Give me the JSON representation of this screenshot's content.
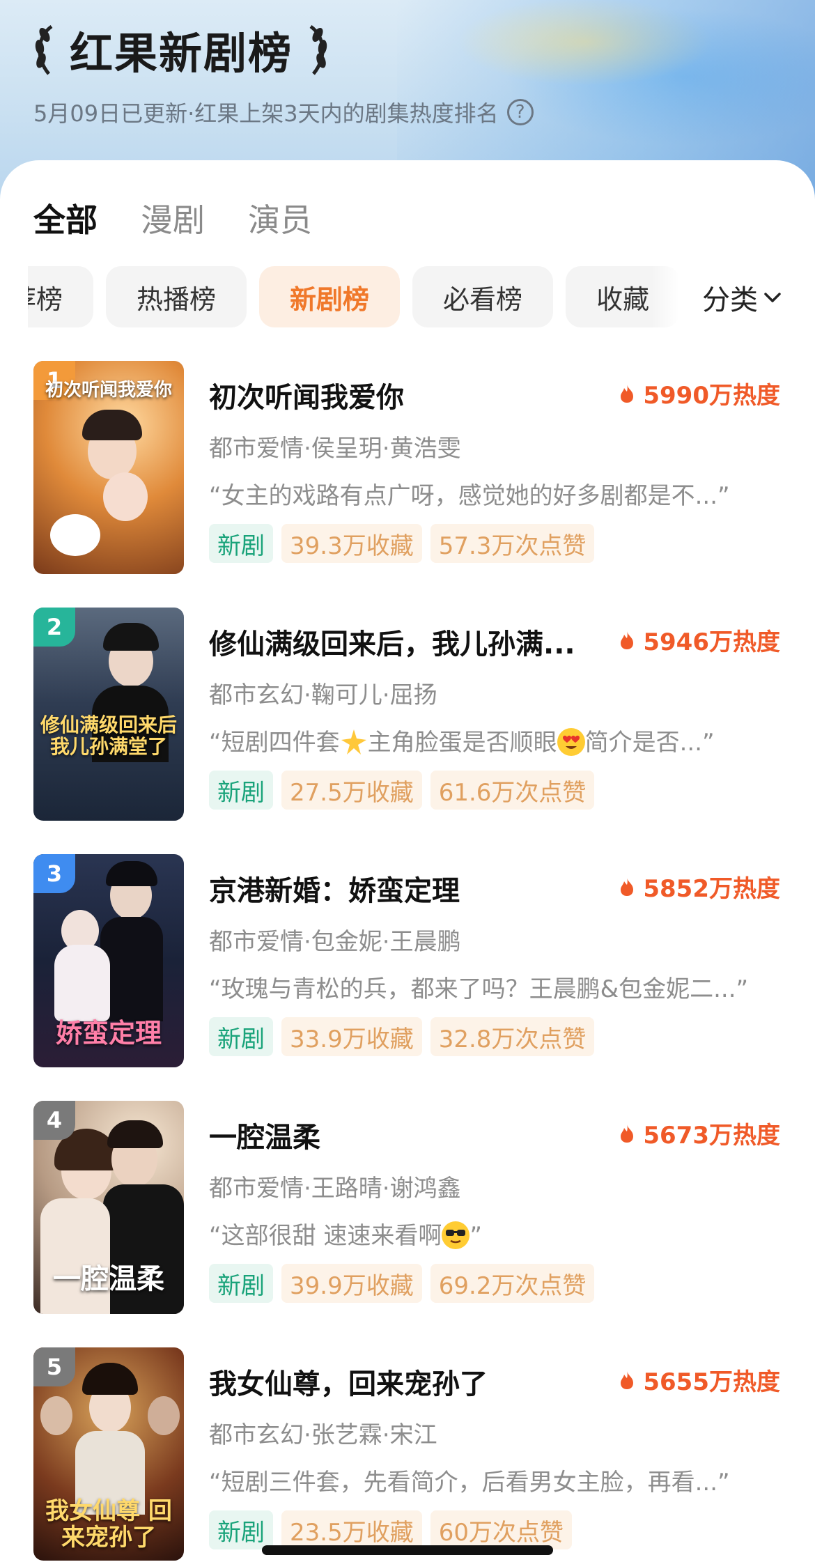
{
  "header": {
    "title": "红果新剧榜",
    "subtitle": "5月09日已更新·红果上架3天内的剧集热度排名",
    "help_glyph": "?"
  },
  "tabs": [
    "全部",
    "漫剧",
    "演员"
  ],
  "chips": [
    "荐榜",
    "热播榜",
    "新剧榜",
    "必看榜",
    "收藏"
  ],
  "category_label": "分类",
  "colors": {
    "accent_orange": "#f0782a",
    "heat_red": "#f05a28",
    "tag_green": "#19a37a",
    "rank1": "#f39a3a",
    "rank2": "#27b59a",
    "rank3": "#3f8cf0",
    "rank_other": "#7a7a7a"
  },
  "items": [
    {
      "rank": "1",
      "title": "初次听闻我爱你",
      "heat": "5990万热度",
      "meta": "都市爱情·侯呈玥·黄浩雯",
      "quote": "“女主的戏路有点广呀，感觉她的好多剧都是不...”",
      "tags": [
        "新剧",
        "39.3万收藏",
        "57.3万次点赞"
      ],
      "poster_text": "初次听闻我爱你"
    },
    {
      "rank": "2",
      "title": "修仙满级回来后，我儿孙满...",
      "heat": "5946万热度",
      "meta": "都市玄幻·鞠可儿·屈扬",
      "quote_a": "“短剧四件套",
      "quote_b": "主角脸蛋是否顺眼",
      "quote_c": "简介是否...”",
      "tags": [
        "新剧",
        "27.5万收藏",
        "61.6万次点赞"
      ],
      "poster_text": "修仙满级回来后 我儿孙满堂了"
    },
    {
      "rank": "3",
      "title": "京港新婚：娇蛮定理",
      "heat": "5852万热度",
      "meta": "都市爱情·包金妮·王晨鹏",
      "quote": "“玫瑰与青松的兵，都来了吗？王晨鹏&包金妮二...”",
      "tags": [
        "新剧",
        "33.9万收藏",
        "32.8万次点赞"
      ],
      "poster_text": "娇蛮定理"
    },
    {
      "rank": "4",
      "title": "一腔温柔",
      "heat": "5673万热度",
      "meta": "都市爱情·王路晴·谢鸿鑫",
      "quote_a": "“这部很甜 速速来看啊",
      "quote_c": "”",
      "tags": [
        "新剧",
        "39.9万收藏",
        "69.2万次点赞"
      ],
      "poster_text": "一腔温柔"
    },
    {
      "rank": "5",
      "title": "我女仙尊，回来宠孙了",
      "heat": "5655万热度",
      "meta": "都市玄幻·张艺霖·宋江",
      "quote": "“短剧三件套，先看简介，后看男女主脸，再看...”",
      "tags": [
        "新剧",
        "23.5万收藏",
        "60万次点赞"
      ],
      "poster_text": "我女仙尊 回来宠孙了"
    }
  ]
}
